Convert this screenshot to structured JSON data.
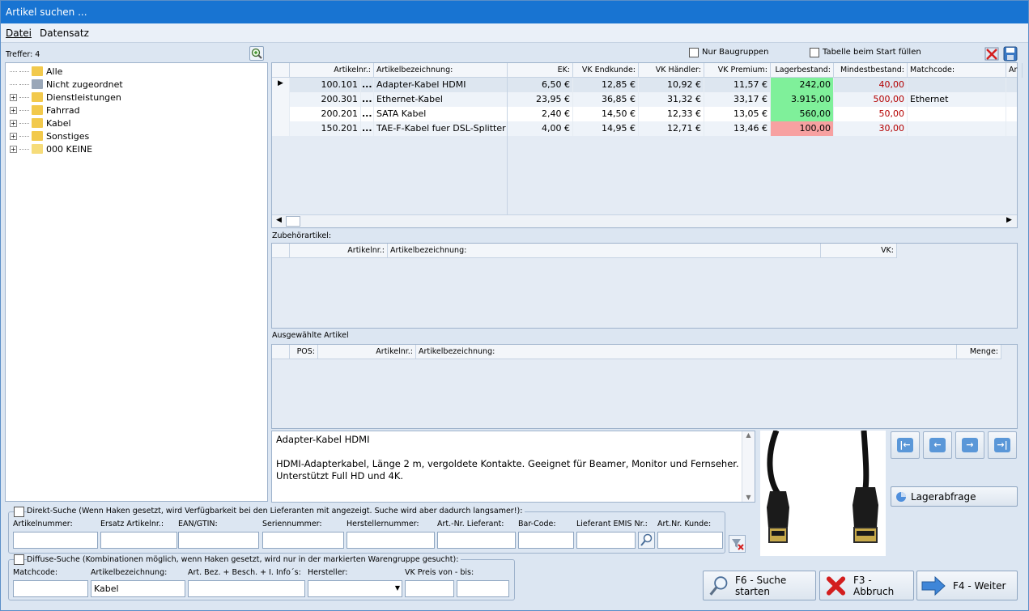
{
  "window": {
    "title": "Artikel suchen ..."
  },
  "menu": {
    "datei": "Datei",
    "datensatz": "Datensatz"
  },
  "tree": {
    "hits_label": "Treffer: 4",
    "items": [
      {
        "label": "Alle",
        "expandable": false
      },
      {
        "label": "Nicht zugeordnet",
        "expandable": false
      },
      {
        "label": "Dienstleistungen",
        "expandable": true
      },
      {
        "label": "Fahrrad",
        "expandable": true
      },
      {
        "label": "Kabel",
        "expandable": true
      },
      {
        "label": "Sonstiges",
        "expandable": true
      },
      {
        "label": "000 KEINE",
        "expandable": true
      }
    ]
  },
  "options": {
    "nur_baugruppen": "Nur Baugruppen",
    "tabelle_start": "Tabelle beim Start füllen"
  },
  "articles": {
    "columns": [
      "Artikelnr.:",
      "Artikelbezeichnung:",
      "EK:",
      "VK Endkunde:",
      "VK Händler:",
      "VK Premium:",
      "Lagerbestand:",
      "Mindestbestand:",
      "Matchcode:",
      "Ar"
    ],
    "rows": [
      {
        "nr": "100.101",
        "more": "...",
        "name": "Adapter-Kabel HDMI",
        "ek": "6,50 €",
        "vk_end": "12,85 €",
        "vk_haendler": "10,92 €",
        "vk_premium": "11,57 €",
        "lager": "242,00",
        "mindest": "40,00",
        "matchcode": "",
        "lager_status": "ok"
      },
      {
        "nr": "200.301",
        "more": "...",
        "name": "Ethernet-Kabel",
        "ek": "23,95 €",
        "vk_end": "36,85 €",
        "vk_haendler": "31,32 €",
        "vk_premium": "33,17 €",
        "lager": "3.915,00",
        "mindest": "500,00",
        "matchcode": "Ethernet",
        "lager_status": "ok"
      },
      {
        "nr": "200.201",
        "more": "...",
        "name": "SATA Kabel",
        "ek": "2,40 €",
        "vk_end": "14,50 €",
        "vk_haendler": "12,33 €",
        "vk_premium": "13,05 €",
        "lager": "560,00",
        "mindest": "50,00",
        "matchcode": "",
        "lager_status": "ok"
      },
      {
        "nr": "150.201",
        "more": "...",
        "name": "TAE-F-Kabel fuer DSL-Splitter",
        "ek": "4,00 €",
        "vk_end": "14,95 €",
        "vk_haendler": "12,71 €",
        "vk_premium": "13,46 €",
        "lager": "100,00",
        "mindest": "30,00",
        "matchcode": "",
        "lager_status": "low"
      }
    ]
  },
  "zubehoer": {
    "label": "Zubehörartikel:",
    "columns": [
      "Artikelnr.:",
      "Artikelbezeichnung:",
      "VK:"
    ]
  },
  "ausgewaehlt": {
    "label": "Ausgewählte Artikel",
    "columns": [
      "POS:",
      "Artikelnr.:",
      "Artikelbezeichnung:",
      "Menge:"
    ]
  },
  "description": {
    "title": "Adapter-Kabel HDMI",
    "line1": "HDMI-Adapterkabel, Länge 2 m, vergoldete Kontakte. Geeignet für Beamer, Monitor und Fernseher.",
    "line2": "Unterstützt Full HD und 4K."
  },
  "lagerabfrage": "Lagerabfrage",
  "direkt": {
    "title": "Direkt-Suche (Wenn Haken gesetzt, wird Verfügbarkeit bei den Lieferanten mit angezeigt. Suche wird aber dadurch langsamer!):",
    "fields": [
      "Artikelnummer:",
      "Ersatz Artikelnr.:",
      "EAN/GTIN:",
      "Seriennummer:",
      "Herstellernummer:",
      "Art.-Nr. Lieferant:",
      "Bar-Code:",
      "Lieferant EMIS Nr.:",
      "Art.Nr. Kunde:"
    ]
  },
  "diffus": {
    "title": "Diffuse-Suche (Kombinationen möglich, wenn Haken gesetzt, wird nur in der markierten Warengruppe gesucht):",
    "fields": [
      "Matchcode:",
      "Artikelbezeichnung:",
      "Art. Bez. + Besch. + I. Info´s:",
      "Hersteller:",
      "VK Preis von - bis:"
    ],
    "artikelbezeichnung_value": "Kabel"
  },
  "buttons": {
    "suche": "F6 - Suche starten",
    "abbruch": "F3 - Abbruch",
    "weiter": "F4 - Weiter"
  },
  "colors": {
    "titlebar": "#1874d2",
    "stock_ok": "#7ff09a",
    "stock_low": "#f7a1a1"
  }
}
